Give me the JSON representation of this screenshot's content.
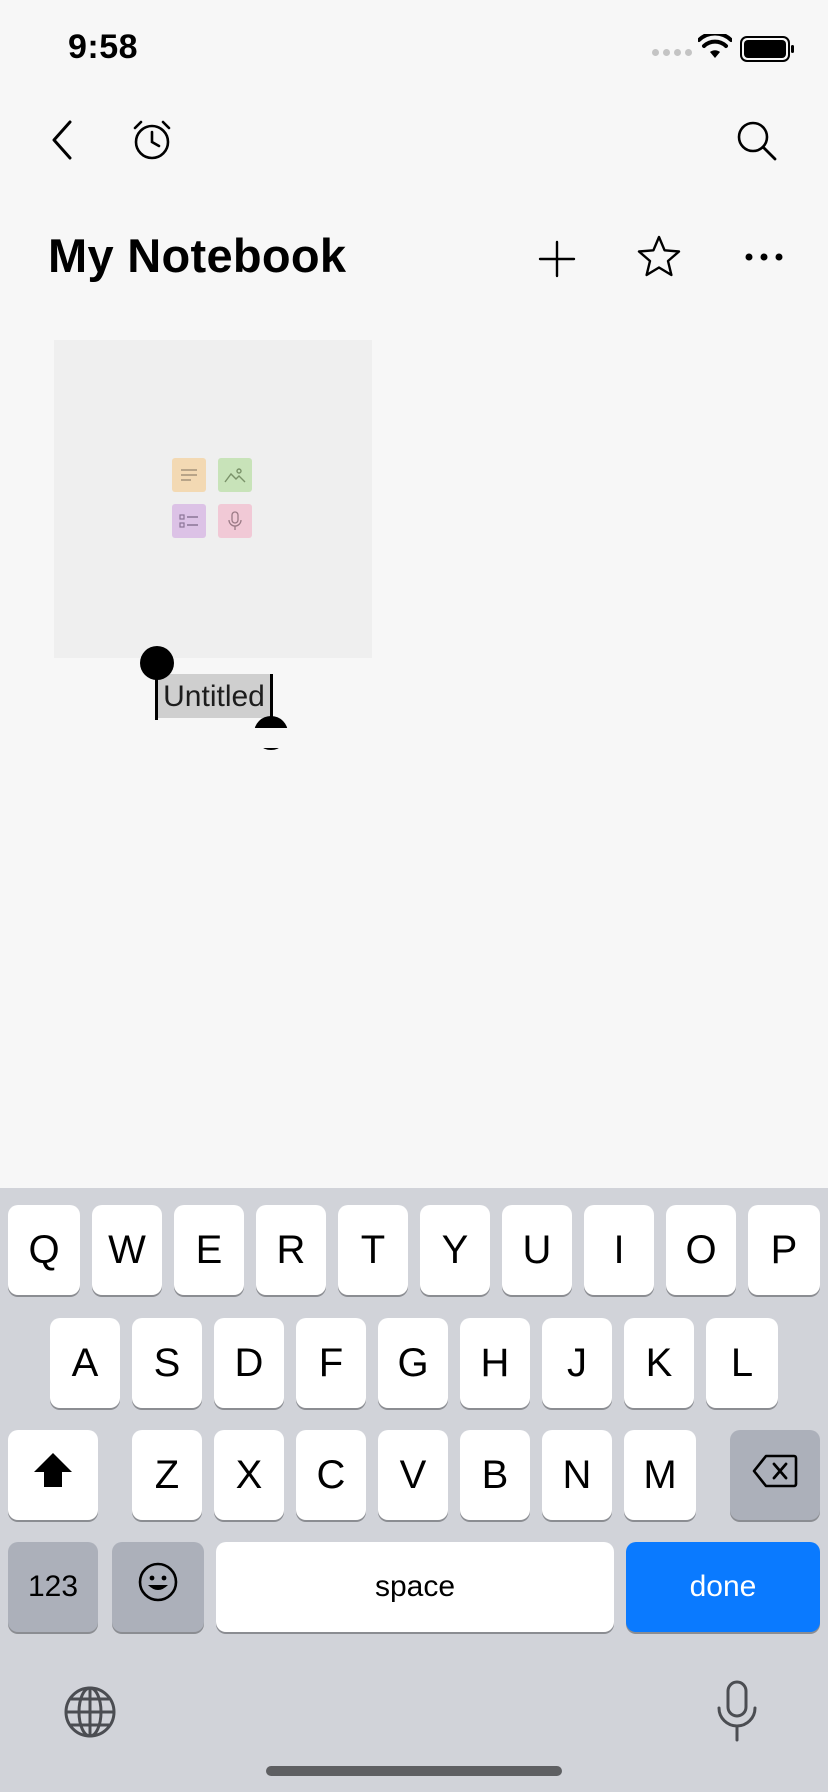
{
  "status_bar": {
    "time": "9:58"
  },
  "header": {
    "title": "My Notebook"
  },
  "note": {
    "title": "Untitled"
  },
  "keyboard": {
    "row1": [
      "Q",
      "W",
      "E",
      "R",
      "T",
      "Y",
      "U",
      "I",
      "O",
      "P"
    ],
    "row2": [
      "A",
      "S",
      "D",
      "F",
      "G",
      "H",
      "J",
      "K",
      "L"
    ],
    "row3": [
      "Z",
      "X",
      "C",
      "V",
      "B",
      "N",
      "M"
    ],
    "numbers_label": "123",
    "space_label": "space",
    "done_label": "done"
  },
  "colors": {
    "accent_done": "#0a7aff",
    "tile_text": "#f3d9b3",
    "tile_image": "#c8e3b9",
    "tile_checklist": "#dcc2e6",
    "tile_audio": "#f1c9d6"
  }
}
